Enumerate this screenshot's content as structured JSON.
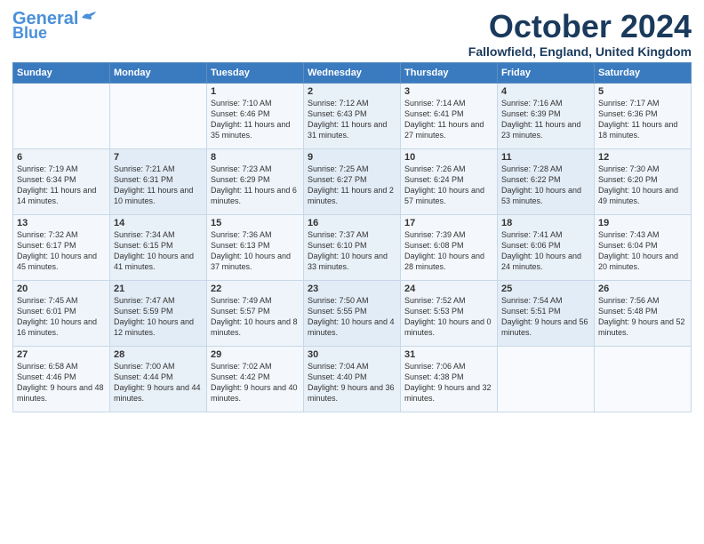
{
  "header": {
    "logo_line1": "General",
    "logo_line2": "Blue",
    "month": "October 2024",
    "location": "Fallowfield, England, United Kingdom"
  },
  "days_of_week": [
    "Sunday",
    "Monday",
    "Tuesday",
    "Wednesday",
    "Thursday",
    "Friday",
    "Saturday"
  ],
  "weeks": [
    [
      {
        "day": "",
        "data": ""
      },
      {
        "day": "",
        "data": ""
      },
      {
        "day": "1",
        "data": "Sunrise: 7:10 AM\nSunset: 6:46 PM\nDaylight: 11 hours and 35 minutes."
      },
      {
        "day": "2",
        "data": "Sunrise: 7:12 AM\nSunset: 6:43 PM\nDaylight: 11 hours and 31 minutes."
      },
      {
        "day": "3",
        "data": "Sunrise: 7:14 AM\nSunset: 6:41 PM\nDaylight: 11 hours and 27 minutes."
      },
      {
        "day": "4",
        "data": "Sunrise: 7:16 AM\nSunset: 6:39 PM\nDaylight: 11 hours and 23 minutes."
      },
      {
        "day": "5",
        "data": "Sunrise: 7:17 AM\nSunset: 6:36 PM\nDaylight: 11 hours and 18 minutes."
      }
    ],
    [
      {
        "day": "6",
        "data": "Sunrise: 7:19 AM\nSunset: 6:34 PM\nDaylight: 11 hours and 14 minutes."
      },
      {
        "day": "7",
        "data": "Sunrise: 7:21 AM\nSunset: 6:31 PM\nDaylight: 11 hours and 10 minutes."
      },
      {
        "day": "8",
        "data": "Sunrise: 7:23 AM\nSunset: 6:29 PM\nDaylight: 11 hours and 6 minutes."
      },
      {
        "day": "9",
        "data": "Sunrise: 7:25 AM\nSunset: 6:27 PM\nDaylight: 11 hours and 2 minutes."
      },
      {
        "day": "10",
        "data": "Sunrise: 7:26 AM\nSunset: 6:24 PM\nDaylight: 10 hours and 57 minutes."
      },
      {
        "day": "11",
        "data": "Sunrise: 7:28 AM\nSunset: 6:22 PM\nDaylight: 10 hours and 53 minutes."
      },
      {
        "day": "12",
        "data": "Sunrise: 7:30 AM\nSunset: 6:20 PM\nDaylight: 10 hours and 49 minutes."
      }
    ],
    [
      {
        "day": "13",
        "data": "Sunrise: 7:32 AM\nSunset: 6:17 PM\nDaylight: 10 hours and 45 minutes."
      },
      {
        "day": "14",
        "data": "Sunrise: 7:34 AM\nSunset: 6:15 PM\nDaylight: 10 hours and 41 minutes."
      },
      {
        "day": "15",
        "data": "Sunrise: 7:36 AM\nSunset: 6:13 PM\nDaylight: 10 hours and 37 minutes."
      },
      {
        "day": "16",
        "data": "Sunrise: 7:37 AM\nSunset: 6:10 PM\nDaylight: 10 hours and 33 minutes."
      },
      {
        "day": "17",
        "data": "Sunrise: 7:39 AM\nSunset: 6:08 PM\nDaylight: 10 hours and 28 minutes."
      },
      {
        "day": "18",
        "data": "Sunrise: 7:41 AM\nSunset: 6:06 PM\nDaylight: 10 hours and 24 minutes."
      },
      {
        "day": "19",
        "data": "Sunrise: 7:43 AM\nSunset: 6:04 PM\nDaylight: 10 hours and 20 minutes."
      }
    ],
    [
      {
        "day": "20",
        "data": "Sunrise: 7:45 AM\nSunset: 6:01 PM\nDaylight: 10 hours and 16 minutes."
      },
      {
        "day": "21",
        "data": "Sunrise: 7:47 AM\nSunset: 5:59 PM\nDaylight: 10 hours and 12 minutes."
      },
      {
        "day": "22",
        "data": "Sunrise: 7:49 AM\nSunset: 5:57 PM\nDaylight: 10 hours and 8 minutes."
      },
      {
        "day": "23",
        "data": "Sunrise: 7:50 AM\nSunset: 5:55 PM\nDaylight: 10 hours and 4 minutes."
      },
      {
        "day": "24",
        "data": "Sunrise: 7:52 AM\nSunset: 5:53 PM\nDaylight: 10 hours and 0 minutes."
      },
      {
        "day": "25",
        "data": "Sunrise: 7:54 AM\nSunset: 5:51 PM\nDaylight: 9 hours and 56 minutes."
      },
      {
        "day": "26",
        "data": "Sunrise: 7:56 AM\nSunset: 5:48 PM\nDaylight: 9 hours and 52 minutes."
      }
    ],
    [
      {
        "day": "27",
        "data": "Sunrise: 6:58 AM\nSunset: 4:46 PM\nDaylight: 9 hours and 48 minutes."
      },
      {
        "day": "28",
        "data": "Sunrise: 7:00 AM\nSunset: 4:44 PM\nDaylight: 9 hours and 44 minutes."
      },
      {
        "day": "29",
        "data": "Sunrise: 7:02 AM\nSunset: 4:42 PM\nDaylight: 9 hours and 40 minutes."
      },
      {
        "day": "30",
        "data": "Sunrise: 7:04 AM\nSunset: 4:40 PM\nDaylight: 9 hours and 36 minutes."
      },
      {
        "day": "31",
        "data": "Sunrise: 7:06 AM\nSunset: 4:38 PM\nDaylight: 9 hours and 32 minutes."
      },
      {
        "day": "",
        "data": ""
      },
      {
        "day": "",
        "data": ""
      }
    ]
  ]
}
